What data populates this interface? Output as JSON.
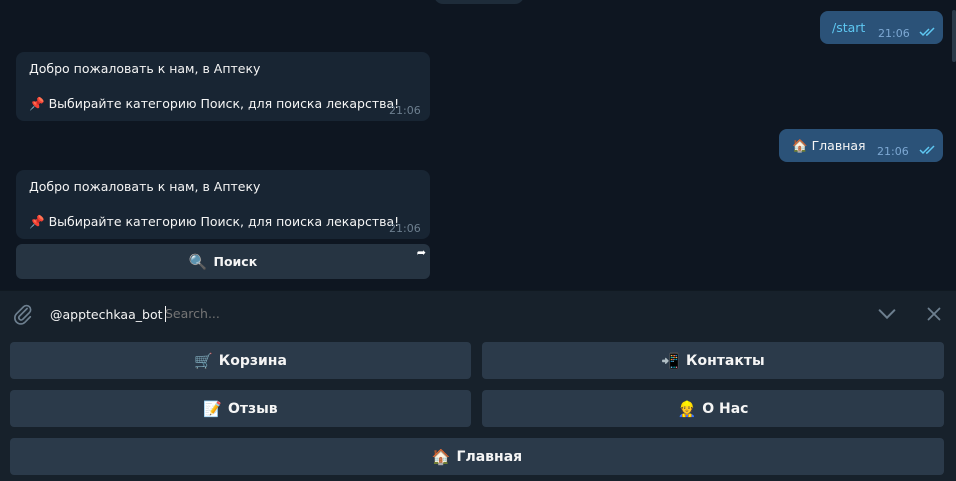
{
  "messages": {
    "out1": {
      "text": "/start",
      "time": "21:06"
    },
    "in1": {
      "line1": "Добро пожаловать к нам, в Аптеку",
      "line2": "Выбирайте категорию Поиск, для поиска лекарства!",
      "pin_emoji": "📌",
      "time": "21:06"
    },
    "out2": {
      "emoji": "🏠",
      "text": "Главная",
      "time": "21:06"
    },
    "in2": {
      "line1": "Добро пожаловать к нам, в Аптеку",
      "line2": "Выбирайте категорию Поиск, для поиска лекарства!",
      "pin_emoji": "📌",
      "time": "21:06"
    }
  },
  "inline_button": {
    "emoji": "🔍",
    "label": "Поиск"
  },
  "input": {
    "typed": "@apptechkaa_bot",
    "placeholder": "Search..."
  },
  "keyboard": {
    "cart": {
      "emoji": "🛒",
      "label": "Корзина"
    },
    "contacts": {
      "emoji": "📲",
      "label": "Контакты"
    },
    "review": {
      "emoji": "📝",
      "label": "Отзыв"
    },
    "about": {
      "emoji": "👷",
      "label": "О Нас"
    },
    "home": {
      "emoji": "🏠",
      "label": "Главная"
    }
  },
  "colors": {
    "chat_bg": "#0e1621",
    "panel_bg": "#17212b",
    "incoming": "#182533",
    "outgoing": "#2b5278",
    "button": "#2b3a4a",
    "read_ticks": "#5ec8f2"
  }
}
